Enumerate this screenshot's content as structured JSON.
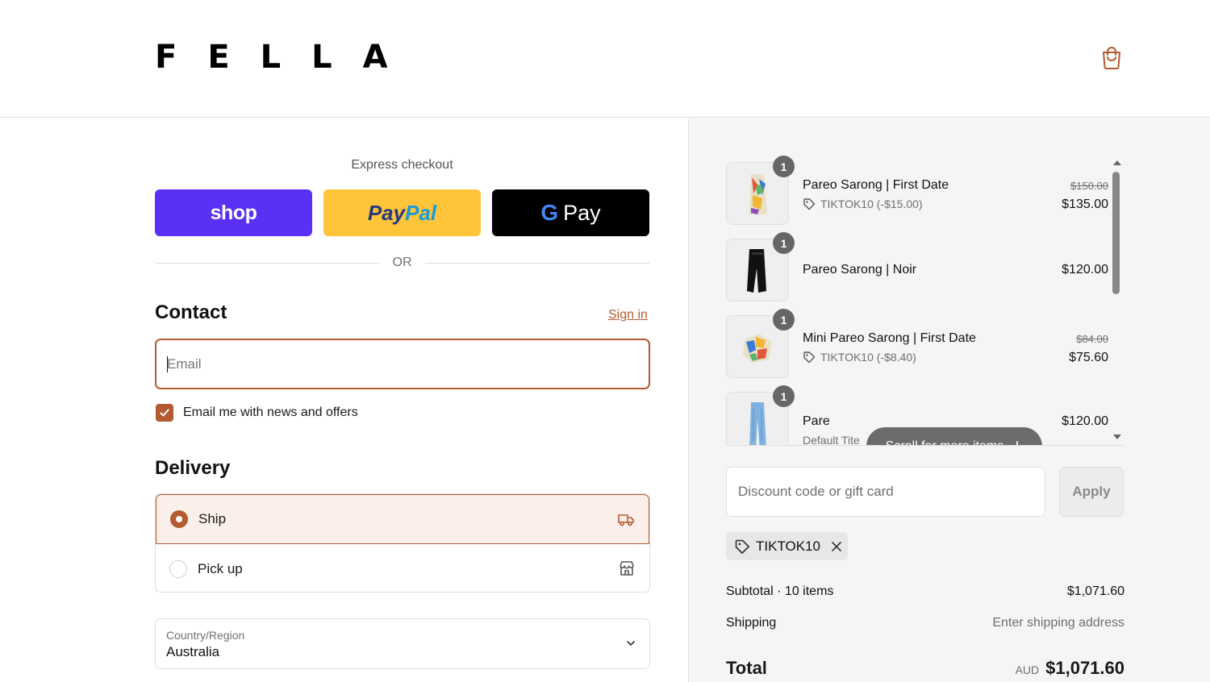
{
  "header": {
    "logo": "FELLA",
    "cart_icon": "shopping-bag-icon"
  },
  "express": {
    "title": "Express checkout",
    "shop_label": "shop",
    "paypal_label_1": "Pay",
    "paypal_label_2": "Pal",
    "gpay_g": "G",
    "gpay_label": "Pay",
    "or_label": "OR"
  },
  "contact": {
    "heading": "Contact",
    "sign_in": "Sign in",
    "email_placeholder": "Email",
    "email_value": "",
    "newsletter_label": "Email me with news and offers",
    "newsletter_checked": true
  },
  "delivery": {
    "heading": "Delivery",
    "options": [
      {
        "label": "Ship",
        "selected": true,
        "icon": "truck-icon"
      },
      {
        "label": "Pick up",
        "selected": false,
        "icon": "store-icon"
      }
    ],
    "country_label": "Country/Region",
    "country_value": "Australia"
  },
  "cart": {
    "items": [
      {
        "qty": "1",
        "name": "Pareo Sarong | First Date",
        "discount": "TIKTOK10 (-$15.00)",
        "original_price": "$150.00",
        "price": "$135.00"
      },
      {
        "qty": "1",
        "name": "Pareo Sarong | Noir",
        "price": "$120.00"
      },
      {
        "qty": "1",
        "name": "Mini Pareo Sarong | First Date",
        "discount": "TIKTOK10 (-$8.40)",
        "original_price": "$84.00",
        "price": "$75.60"
      },
      {
        "qty": "1",
        "name": "Pare",
        "variant": "Default Tite",
        "price": "$120.00"
      }
    ],
    "scroll_hint": "Scroll for more items"
  },
  "discount": {
    "placeholder": "Discount code or gift card",
    "apply_label": "Apply",
    "applied_code": "TIKTOK10"
  },
  "summary": {
    "subtotal_label": "Subtotal · 10 items",
    "subtotal_value": "$1,071.60",
    "shipping_label": "Shipping",
    "shipping_value": "Enter shipping address",
    "total_label": "Total",
    "currency": "AUD",
    "total_value": "$1,071.60"
  },
  "colors": {
    "accent": "#b35a30",
    "shop_pay": "#5a31f4",
    "paypal": "#ffc439",
    "gpay": "#000000"
  }
}
